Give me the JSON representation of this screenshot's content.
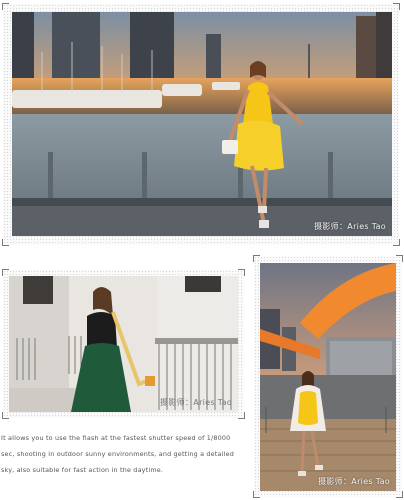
{
  "photos": [
    {
      "id": "harbor",
      "credit": "摄影师：Aries Tao",
      "credit_icon": "camera-credit-icon",
      "subject": "woman in yellow dress on rooftop at sunset marina"
    },
    {
      "id": "street",
      "credit": "摄影师：Aries Tao",
      "credit_icon": "camera-credit-icon",
      "subject": "woman in black top and green skirt by white building"
    },
    {
      "id": "bridge",
      "credit": "摄影师：Aries Tao",
      "credit_icon": "camera-credit-icon",
      "subject": "woman in yellow dress under orange bridge"
    }
  ],
  "caption": "It allows you to use the flash at the fastest shutter speed of 1/8000 sec, shooting in outdoor sunny environments, and getting a detailed sky, also suitable for fast action in the daytime.",
  "colors": {
    "accent_orange": "#f18a2e",
    "sunset": "#f4a24a",
    "dress_yellow": "#f5c518",
    "skirt_green": "#1f5a3a",
    "frame_border": "#7a7a7a"
  }
}
